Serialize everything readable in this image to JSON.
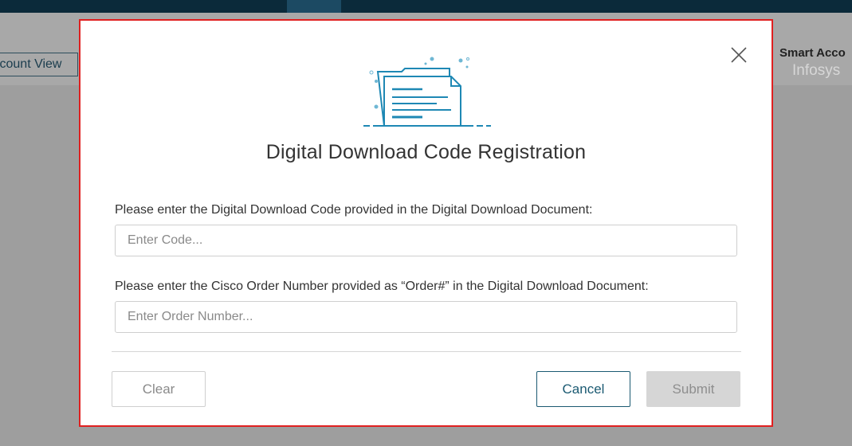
{
  "background": {
    "account_view_label": "count View",
    "smart_account_title": "Smart Acco",
    "smart_account_name": "Infosys"
  },
  "modal": {
    "title": "Digital Download Code Registration",
    "code_label": "Please enter the Digital Download Code provided in the Digital Download Document:",
    "code_placeholder": "Enter Code...",
    "order_label": "Please enter the Cisco Order Number provided as “Order#” in the Digital Download Document:",
    "order_placeholder": "Enter Order Number...",
    "clear_label": "Clear",
    "cancel_label": "Cancel",
    "submit_label": "Submit"
  },
  "icons": {
    "close": "close-icon",
    "illustration": "document-illustration-icon"
  },
  "colors": {
    "accent": "#1b5a72",
    "illustration": "#1e88b4",
    "highlight_border": "#e02020",
    "topbar": "#0b2a3a"
  }
}
